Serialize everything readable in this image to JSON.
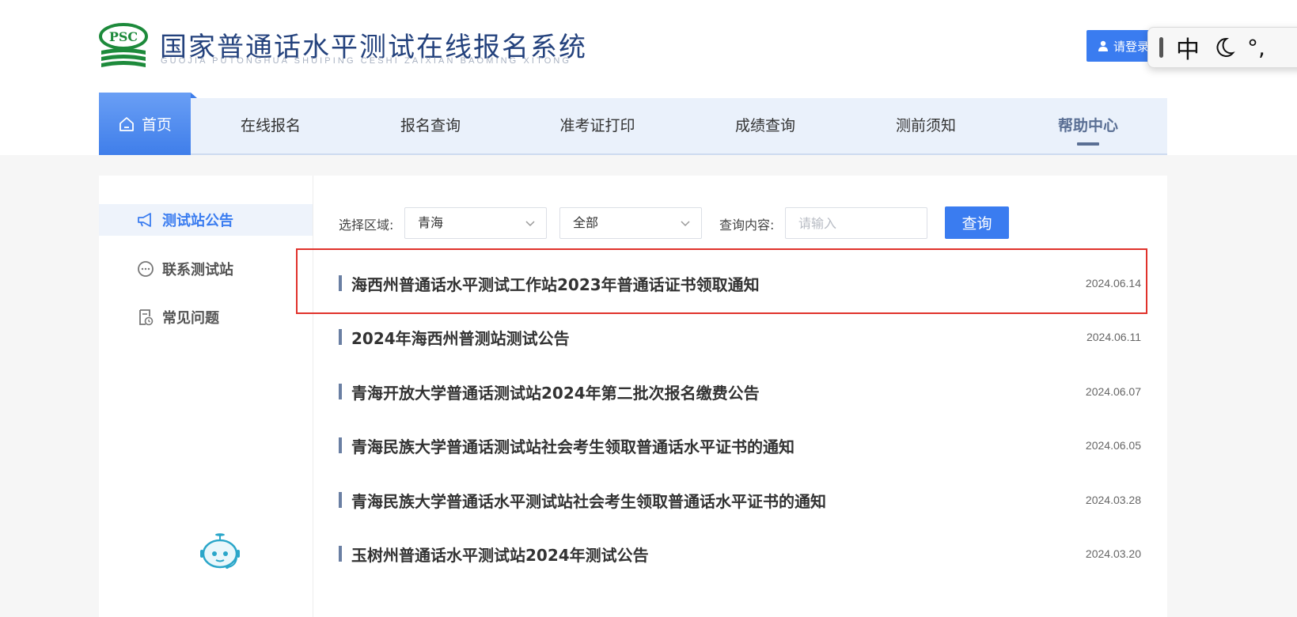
{
  "header": {
    "site_title": "国家普通话水平测试在线报名系统",
    "site_subtitle": "GUOJIA PUTONGHUA SHUIPING CESHI ZAIXIAN BAOMING XITONG",
    "logo_text": "PSC",
    "login_label": "请登录"
  },
  "ime_toolbar": {
    "mode": "中",
    "punct": "°,"
  },
  "nav": {
    "home": "首页",
    "items": [
      "在线报名",
      "报名查询",
      "准考证打印",
      "成绩查询",
      "测前须知",
      "帮助中心"
    ],
    "active": "帮助中心"
  },
  "sidebar": {
    "items": [
      {
        "label": "测试站公告",
        "icon": "megaphone-icon",
        "active": true
      },
      {
        "label": "联系测试站",
        "icon": "chat-bubble-icon",
        "active": false
      },
      {
        "label": "常见问题",
        "icon": "document-clock-icon",
        "active": false
      }
    ]
  },
  "filters": {
    "region_label": "选择区域:",
    "region_value": "青海",
    "sub_region_value": "全部",
    "query_label": "查询内容:",
    "query_placeholder": "请输入",
    "query_button": "查询"
  },
  "notices": [
    {
      "title": "海西州普通话水平测试工作站2023年普通话证书领取通知",
      "date": "2024.06.14",
      "highlighted": true
    },
    {
      "title": "2024年海西州普测站测试公告",
      "date": "2024.06.11"
    },
    {
      "title": "青海开放大学普通话测试站2024年第二批次报名缴费公告",
      "date": "2024.06.07"
    },
    {
      "title": "青海民族大学普通话测试站社会考生领取普通话水平证书的通知",
      "date": "2024.06.05"
    },
    {
      "title": "青海民族大学普通话水平测试站社会考生领取普通话水平证书的通知",
      "date": "2024.03.28"
    },
    {
      "title": "玉树州普通话水平测试站2024年测试公告",
      "date": "2024.03.20"
    }
  ],
  "colors": {
    "accent": "#3a7cf0",
    "nav_bg": "#eaf1fb",
    "highlight_border": "#e0322b",
    "logo_green": "#1d8a3b"
  }
}
